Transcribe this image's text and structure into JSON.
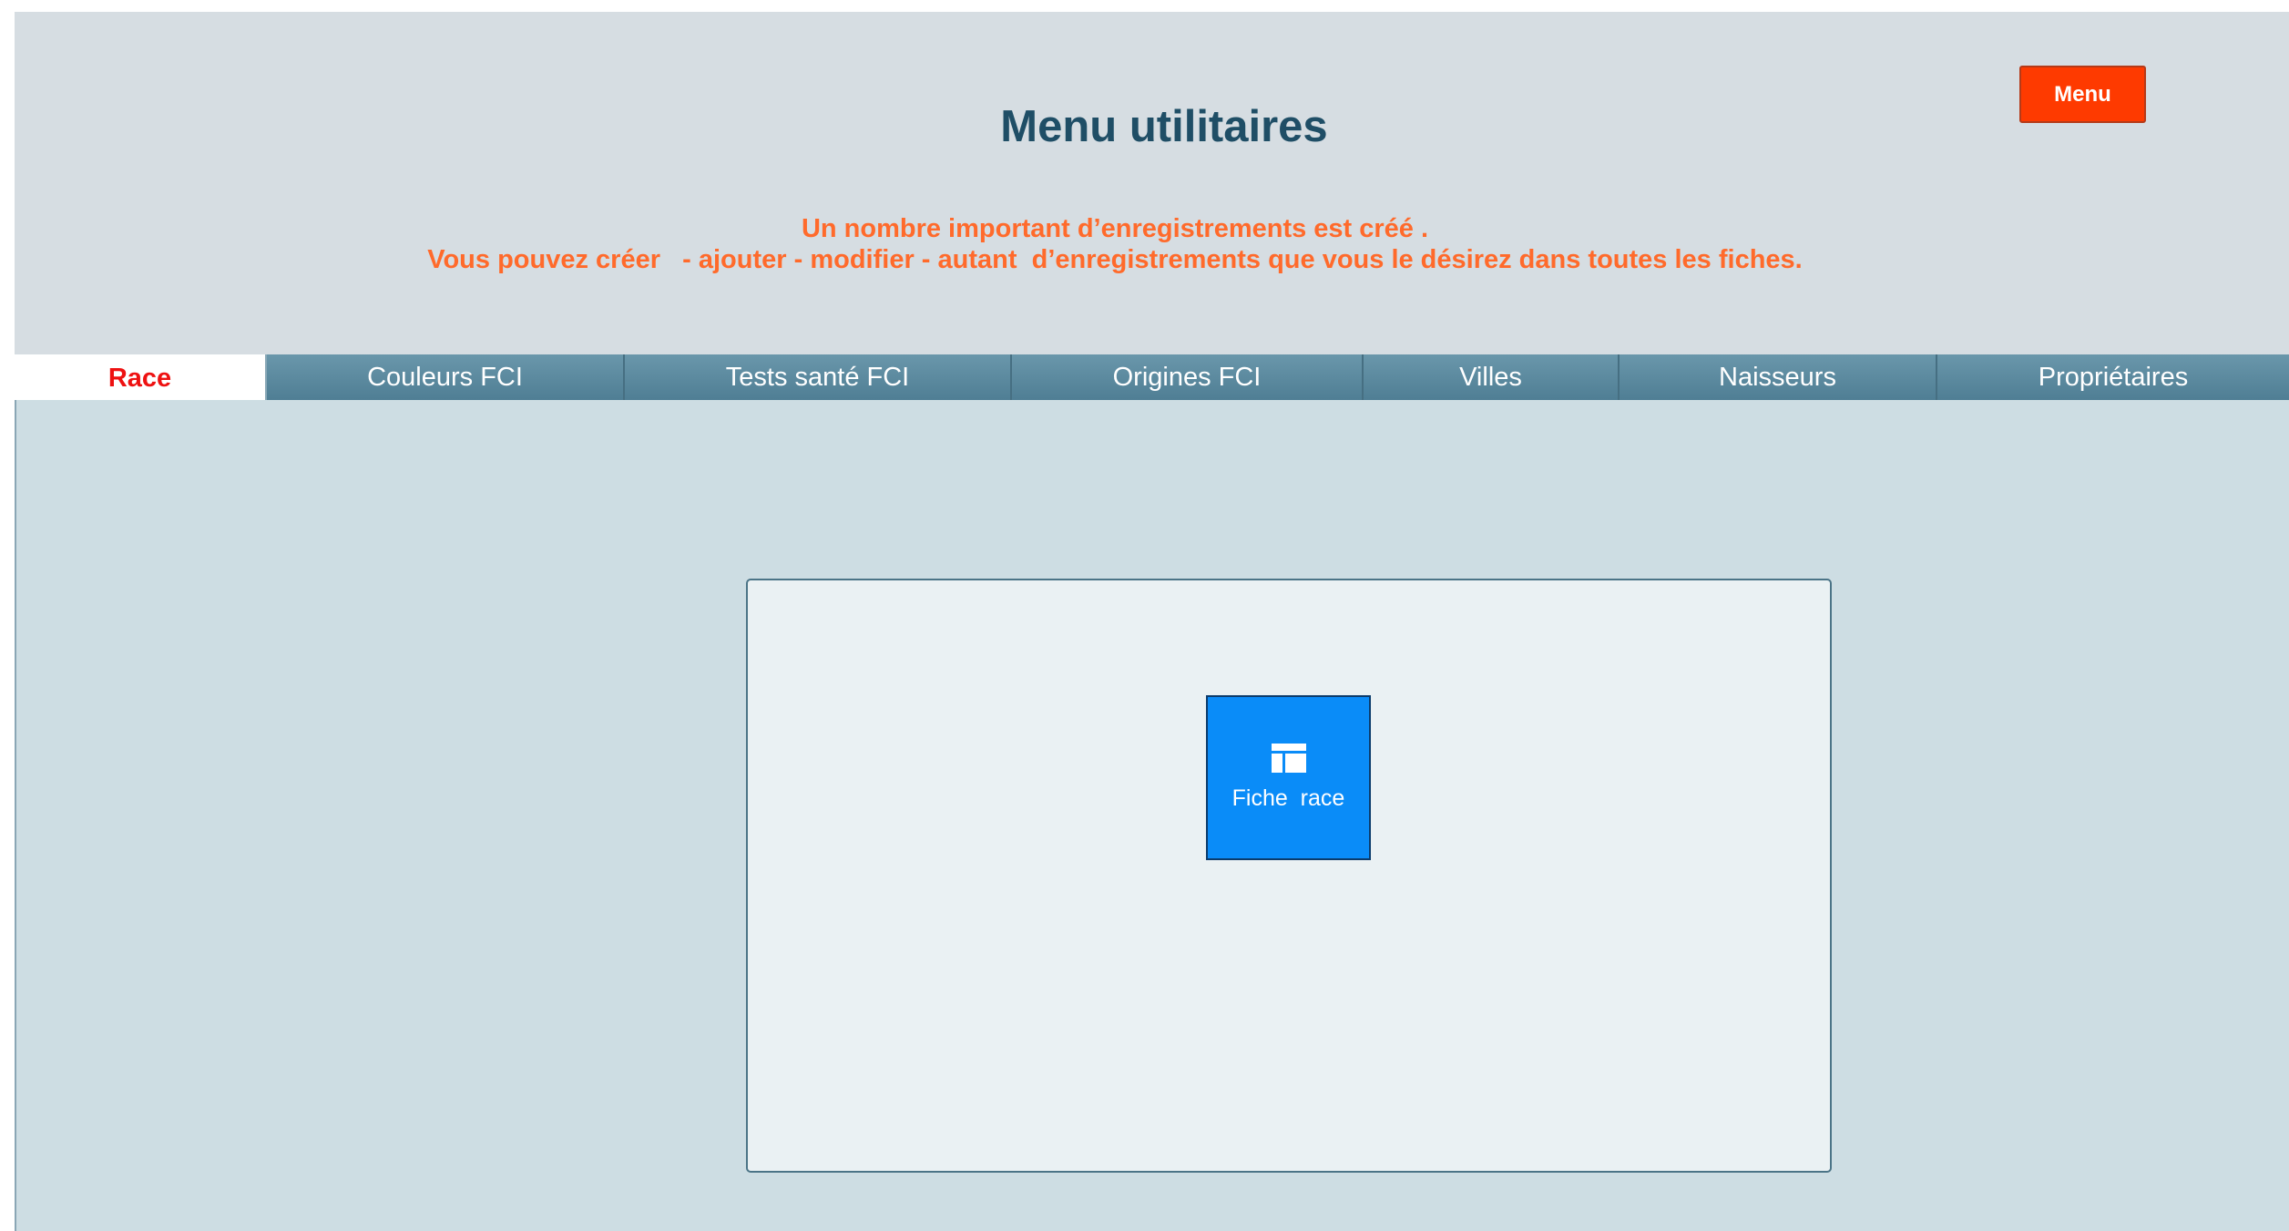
{
  "header": {
    "title": "Menu utilitaires",
    "menu_button": "Menu",
    "notice_line1": "Un nombre important d’enregistrements est créé .",
    "notice_line2": "Vous pouvez créer   - ajouter - modifier - autant  d’enregistrements que vous le désirez dans toutes les fiches."
  },
  "tabs": [
    {
      "label": "Race",
      "active": true
    },
    {
      "label": "Couleurs FCI",
      "active": false
    },
    {
      "label": "Tests santé FCI",
      "active": false
    },
    {
      "label": "Origines FCI",
      "active": false
    },
    {
      "label": "Villes",
      "active": false
    },
    {
      "label": "Naisseurs",
      "active": false
    },
    {
      "label": "Propriétaires",
      "active": false
    }
  ],
  "panel": {
    "tile_label": "Fiche  race",
    "tile_icon": "table-icon"
  },
  "colors": {
    "title": "#1f4e66",
    "notice": "#ff6a2b",
    "menu_button": "#fe3a00",
    "active_tab_text": "#ee1111",
    "tab_bar": "#5b8aa0",
    "tile": "#0a8cf8"
  }
}
